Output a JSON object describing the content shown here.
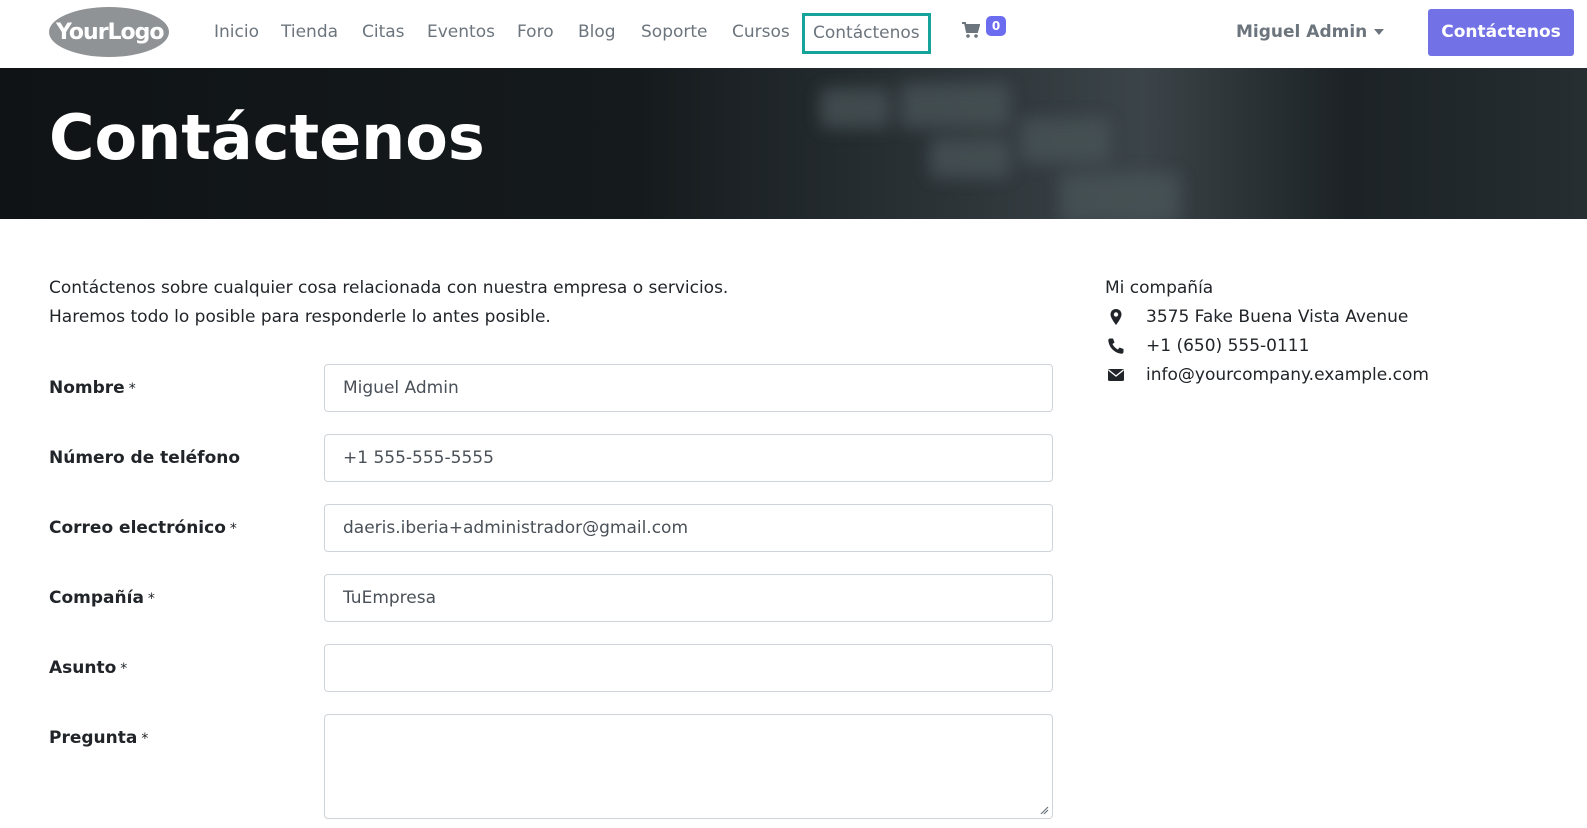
{
  "header": {
    "logo_text": "YourLogo",
    "nav": [
      "Inicio",
      "Tienda",
      "Citas",
      "Eventos",
      "Foro",
      "Blog",
      "Soporte",
      "Cursos",
      "Contáctenos"
    ],
    "cart_count": "0",
    "user_name": "Miguel Admin",
    "cta_label": "Contáctenos"
  },
  "hero": {
    "title": "Contáctenos"
  },
  "intro": {
    "line1": "Contáctenos sobre cualquier cosa relacionada con nuestra empresa o servicios.",
    "line2": "Haremos todo lo posible para responderle lo antes posible."
  },
  "form": {
    "required_mark": "*",
    "fields": [
      {
        "label": "Nombre",
        "value": "Miguel Admin",
        "required": true
      },
      {
        "label": "Número de teléfono",
        "value": "+1 555-555-5555",
        "required": false
      },
      {
        "label": "Correo electrónico",
        "value": "daeris.iberia+administrador@gmail.com",
        "required": true
      },
      {
        "label": "Compañía",
        "value": "TuEmpresa",
        "required": true
      },
      {
        "label": "Asunto",
        "value": "",
        "required": true
      },
      {
        "label": "Pregunta",
        "value": "",
        "required": true
      }
    ]
  },
  "company": {
    "name": "Mi compañía",
    "address": "3575 Fake Buena Vista Avenue",
    "phone": "+1 (650) 555-0111",
    "email": "info@yourcompany.example.com",
    "icons": [
      "map-marker-icon",
      "phone-icon",
      "envelope-icon"
    ]
  },
  "colors": {
    "accent": "#7272e6",
    "active_outline": "#16a39a",
    "muted_text": "#6c757d",
    "hero_bg": "#151a1d"
  }
}
